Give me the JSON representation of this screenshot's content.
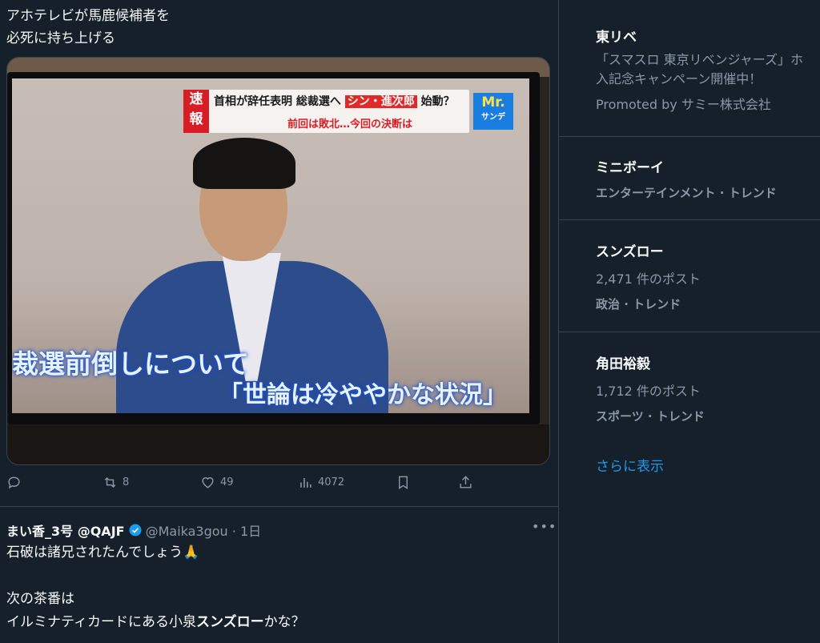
{
  "post": {
    "text": "アホテレビが馬鹿候補者を\n必死に持ち上げる",
    "media": {
      "breaking_label": "速報",
      "headline_part1": "首相が辞任表明 総裁選へ",
      "headline_highlight": "シン・進次郎",
      "headline_part2": "始動？",
      "subline": "前回は敗北…今回の決断は",
      "logo_main": "Mr.",
      "logo_sub": "サンデ",
      "caption_line1": "裁選前倒しについて",
      "caption_line2": "「世論は冷ややかな状況」"
    },
    "actions": {
      "reply_icon": "reply-icon",
      "retweet_icon": "retweet-icon",
      "retweet_count": "8",
      "like_icon": "heart-icon",
      "like_count": "49",
      "views_icon": "analytics-icon",
      "views_count": "4072",
      "bookmark_icon": "bookmark-icon",
      "share_icon": "share-icon"
    }
  },
  "reply": {
    "display_name": "まい香_3号 @QAJF",
    "handle_time": "@Maika3gou · 1日",
    "line1": "石破は諸兄されたんでしょう🙏",
    "line2": "次の茶番は",
    "line3_prefix": "イルミナティカードにある小泉",
    "line3_bold": "スンズロー",
    "line3_suffix": "かな？",
    "more_icon": "more-icon"
  },
  "trends": [
    {
      "title": "東リベ",
      "promo_text": "「スマスロ 東京リベンジャーズ」ホ\n入記念キャンペーン開催中！",
      "meta": "Promoted by サミー株式会社"
    },
    {
      "title": "ミニボーイ",
      "meta": "エンターテインメント · トレンド"
    },
    {
      "title": "スンズロー",
      "count": "2,471 件のポスト",
      "meta": "政治 · トレンド"
    },
    {
      "title": "角田裕毅",
      "count": "1,712 件のポスト",
      "meta": "スポーツ · トレンド"
    }
  ],
  "show_more": "さらに表示",
  "colors": {
    "background": "#15202b",
    "text_primary": "#f7f9f9",
    "text_secondary": "#8b98a5",
    "accent": "#1d9bf0",
    "border": "#38444d"
  }
}
